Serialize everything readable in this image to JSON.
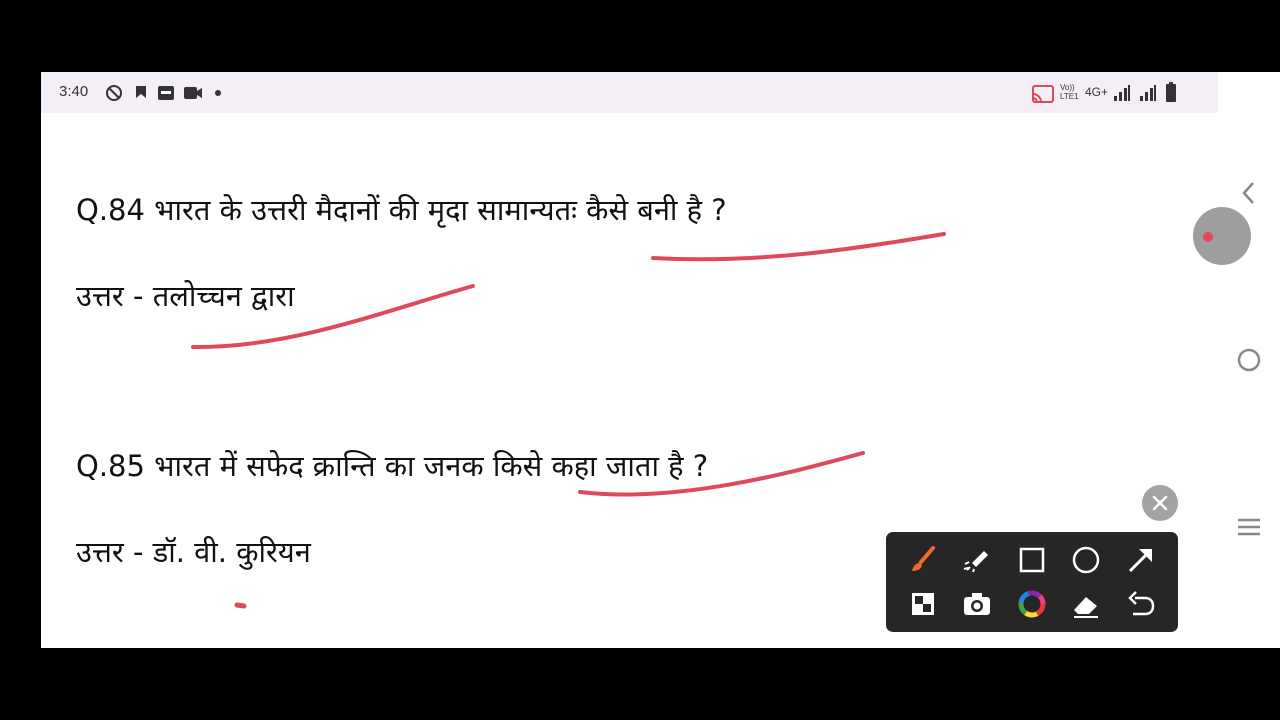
{
  "status_bar": {
    "time": "3:40",
    "network_label": "4G+",
    "volte_label": "Vo)) LTE1",
    "left_icons": [
      "no-disturb-icon",
      "shield-icon",
      "paytm-icon",
      "video-icon",
      "dot-icon"
    ],
    "right_icons": [
      "cast-icon",
      "volte-icon",
      "signal-icon",
      "signal-icon",
      "battery-icon"
    ]
  },
  "content": {
    "q84": "Q.84 भारत के उत्तरी मैदानों की मृदा सामान्यतः कैसे बनी है ?",
    "a84": "उत्तर - तलोच्चन द्वारा",
    "q85": "Q.85 भारत में सफेद क्रान्ति का जनक किसे कहा जाता है ?",
    "a85": "उत्तर - डॉ. वी. कुरियन"
  },
  "annotations": {
    "ink_color": "#e0485e"
  },
  "nav_bar": {
    "buttons": [
      "back-icon",
      "home-icon",
      "menu-icon"
    ]
  },
  "toolbox": {
    "tools": [
      "brush-icon",
      "laser-pointer-icon",
      "rectangle-icon",
      "circle-icon",
      "arrow-icon",
      "mosaic-icon",
      "camera-icon",
      "color-wheel-icon",
      "eraser-icon",
      "undo-icon"
    ],
    "active_color": "#f26a2b"
  }
}
